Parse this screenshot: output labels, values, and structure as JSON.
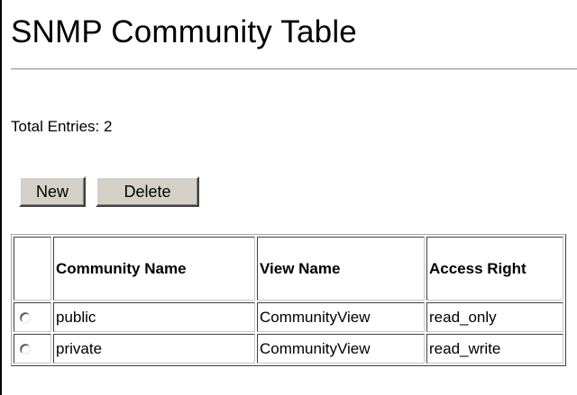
{
  "page": {
    "title": "SNMP Community Table",
    "total_entries_label": "Total Entries: 2"
  },
  "toolbar": {
    "new_label": "New",
    "delete_label": "Delete"
  },
  "table": {
    "headers": [
      "",
      "Community Name",
      "View Name",
      "Access Right"
    ],
    "rows": [
      {
        "selected": false,
        "community_name": "public",
        "view_name": "CommunityView",
        "access_right": "read_only"
      },
      {
        "selected": false,
        "community_name": "private",
        "view_name": "CommunityView",
        "access_right": "read_write"
      }
    ]
  }
}
